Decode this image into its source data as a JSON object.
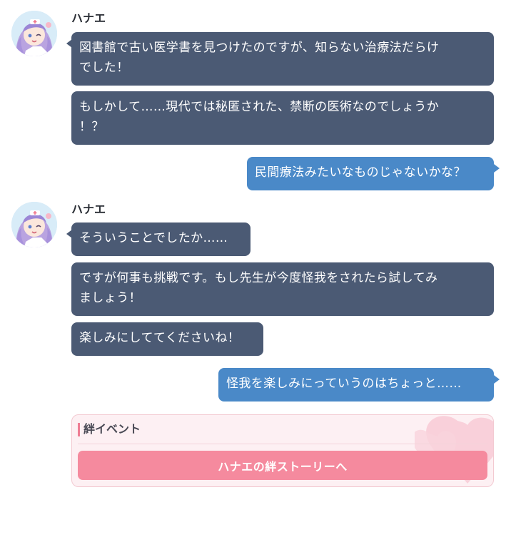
{
  "conversation": {
    "speaker_name": "ハナエ",
    "group1": {
      "messages": [
        {
          "lines": [
            "図書館で古い医学書を見つけたのですが、知らない治療法だらけ",
            "でした！"
          ]
        },
        {
          "lines": [
            "もしかして……現代では秘匿された、禁断の医術なのでしょうか",
            "！？"
          ]
        }
      ]
    },
    "reply1": "民間療法みたいなものじゃないかな？",
    "group2": {
      "messages": [
        {
          "lines": [
            "そういうことでしたか……"
          ]
        },
        {
          "lines": [
            "ですが何事も挑戦です。もし先生が今度怪我をされたら試してみ",
            "ましょう！"
          ]
        },
        {
          "lines": [
            "楽しみにしててくださいね！"
          ]
        }
      ]
    },
    "reply2": "怪我を楽しみにっていうのはちょっと……"
  },
  "bond_event": {
    "title": "絆イベント",
    "button_label": "ハナエの絆ストーリーへ"
  },
  "colors": {
    "incoming_bubble": "#4b5a74",
    "outgoing_bubble": "#4a89c8",
    "bond_button": "#f58a9e",
    "bond_card_bg": "#fdf0f3"
  },
  "icons": {
    "avatar": "hanae-avatar",
    "decoration": "heart-icon"
  }
}
